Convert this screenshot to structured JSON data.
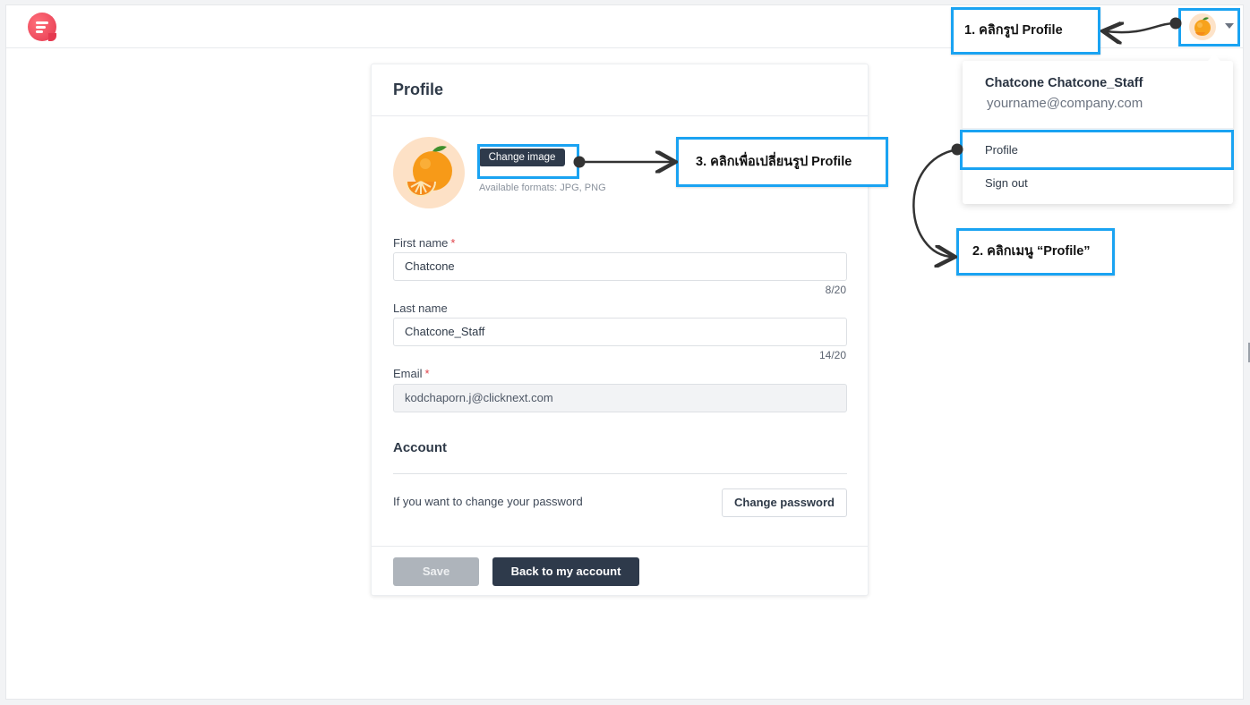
{
  "app": {
    "logo_icon": "chat-logo-icon"
  },
  "header": {
    "avatar_icon": "orange-avatar-icon",
    "menu_caret_icon": "chevron-down-icon"
  },
  "profile_card": {
    "title": "Profile",
    "change_image_label": "Change image",
    "formats_text": "Available formats: JPG, PNG",
    "first_name": {
      "label": "First name",
      "required_mark": "*",
      "value": "Chatcone",
      "counter": "8/20"
    },
    "last_name": {
      "label": "Last name",
      "value": "Chatcone_Staff",
      "counter": "14/20"
    },
    "email": {
      "label": "Email",
      "required_mark": "*",
      "value": "kodchaporn.j@clicknext.com"
    },
    "account": {
      "title": "Account",
      "password_text": "If you want to change your password",
      "change_password_label": "Change password"
    },
    "save_label": "Save",
    "back_label": "Back to my account"
  },
  "user_menu": {
    "name": "Chatcone Chatcone_Staff",
    "email": "yourname@company.com",
    "items": [
      {
        "label": "Profile"
      },
      {
        "label": "Sign out"
      }
    ]
  },
  "annotations": {
    "step1": "1. คลิกรูป Profile",
    "step2": "2. คลิกเมนู “Profile”",
    "step3": "3. คลิกเพื่อเปลี่ยนรูป Profile",
    "highlight_color": "#1aa3f2"
  }
}
